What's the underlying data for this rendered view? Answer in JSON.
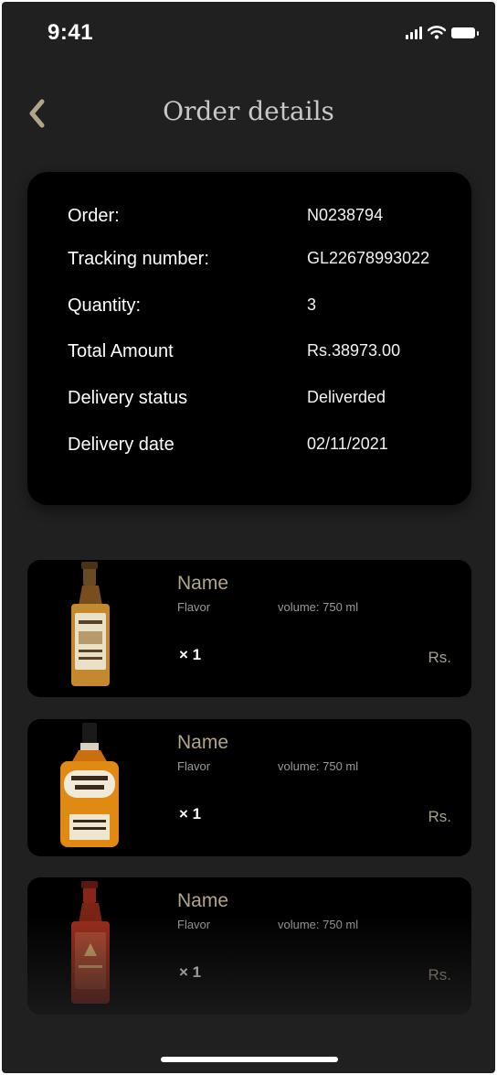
{
  "status_bar": {
    "time": "9:41"
  },
  "header": {
    "title": "Order details"
  },
  "order": {
    "rows": [
      {
        "label": "Order:",
        "value": "N0238794"
      },
      {
        "label": "Tracking number:",
        "value": "GL22678993022"
      },
      {
        "label": "Quantity:",
        "value": "3"
      },
      {
        "label": "Total Amount",
        "value": "Rs.38973.00"
      },
      {
        "label": "Delivery status",
        "value": "Deliverded"
      },
      {
        "label": "Delivery date",
        "value": "02/11/2021"
      }
    ]
  },
  "products": [
    {
      "name": "Name",
      "flavor": "Flavor",
      "volume": "volume: 750 ml",
      "qty": "× 1",
      "price": "Rs."
    },
    {
      "name": "Name",
      "flavor": "Flavor",
      "volume": "volume: 750 ml",
      "qty": "× 1",
      "price": "Rs."
    },
    {
      "name": "Name",
      "flavor": "Flavor",
      "volume": "volume: 750 ml",
      "qty": "× 1",
      "price": "Rs."
    }
  ],
  "icons": [
    "back-chevron-icon",
    "signal-icon",
    "wifi-icon",
    "battery-icon",
    "whiskey-bottle-icon"
  ],
  "colors": {
    "background": "#202020",
    "card": "#000000",
    "accent_gold": "#b3a58a",
    "title_grey": "#c8c8c8"
  }
}
